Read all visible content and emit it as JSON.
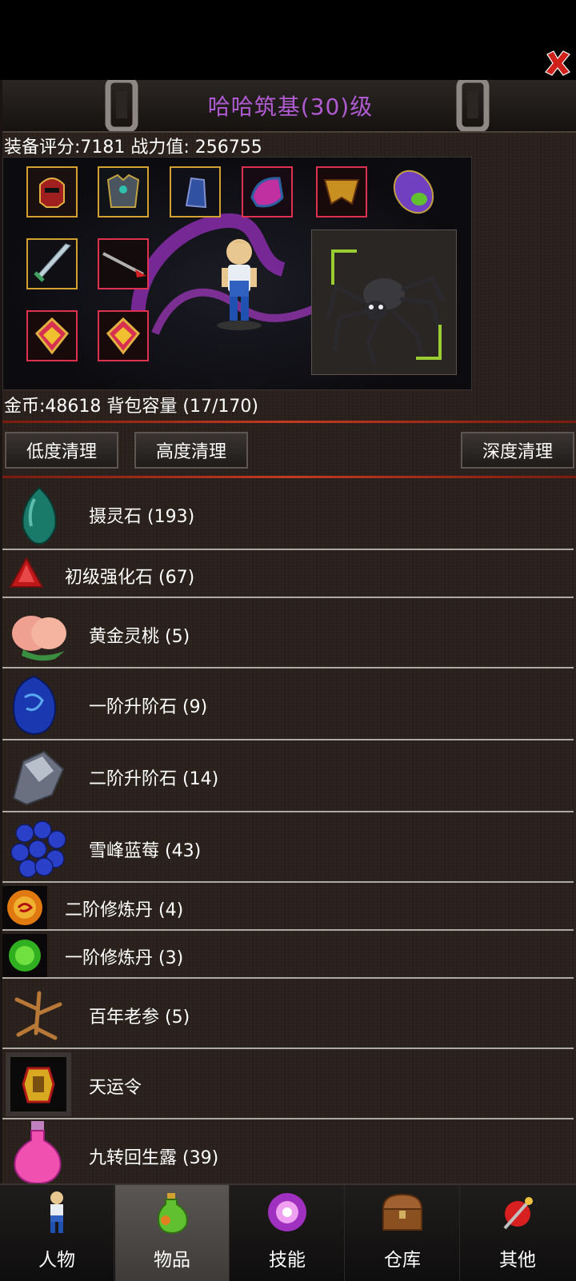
{
  "header": {
    "title": "哈哈筑基(30)级",
    "close_icon": "close-x-icon"
  },
  "stats": {
    "text": "装备评分:7181 战力值: 256755"
  },
  "equipment": {
    "slots": [
      "helmet",
      "armor",
      "bracer",
      "gloves",
      "belt",
      "boots",
      "sword",
      "spear",
      "ring",
      "ring"
    ],
    "pet": "spider"
  },
  "inventory_summary": {
    "text": "金币:48618 背包容量 (17/170)"
  },
  "cleanup": {
    "low": "低度清理",
    "high": "高度清理",
    "deep": "深度清理"
  },
  "items": [
    {
      "label": "摄灵石 (193)",
      "icon": "green-gem-icon"
    },
    {
      "label": "初级强化石 (67)",
      "icon": "red-triangle-gem-icon"
    },
    {
      "label": "黄金灵桃 (5)",
      "icon": "peach-icon"
    },
    {
      "label": "一阶升阶石 (9)",
      "icon": "blue-stone-icon"
    },
    {
      "label": "二阶升阶石 (14)",
      "icon": "silver-stone-icon"
    },
    {
      "label": "雪峰蓝莓 (43)",
      "icon": "blueberry-icon"
    },
    {
      "label": "二阶修炼丹 (4)",
      "icon": "orange-pill-icon"
    },
    {
      "label": "一阶修炼丹 (3)",
      "icon": "green-pill-icon"
    },
    {
      "label": "百年老参 (5)",
      "icon": "ginseng-icon"
    },
    {
      "label": "天运令",
      "icon": "token-icon"
    },
    {
      "label": "九转回生露 (39)",
      "icon": "potion-icon"
    }
  ],
  "nav": {
    "tabs": [
      {
        "label": "人物",
        "icon": "character-icon"
      },
      {
        "label": "物品",
        "icon": "potion-bag-icon"
      },
      {
        "label": "技能",
        "icon": "skill-orb-icon"
      },
      {
        "label": "仓库",
        "icon": "chest-icon"
      },
      {
        "label": "其他",
        "icon": "misc-icon"
      }
    ],
    "active": "物品"
  },
  "colors": {
    "title": "#b05bd1",
    "panel_bg": "#2a211c",
    "divider": "#c23a20",
    "active_tab": "#5a5653"
  }
}
